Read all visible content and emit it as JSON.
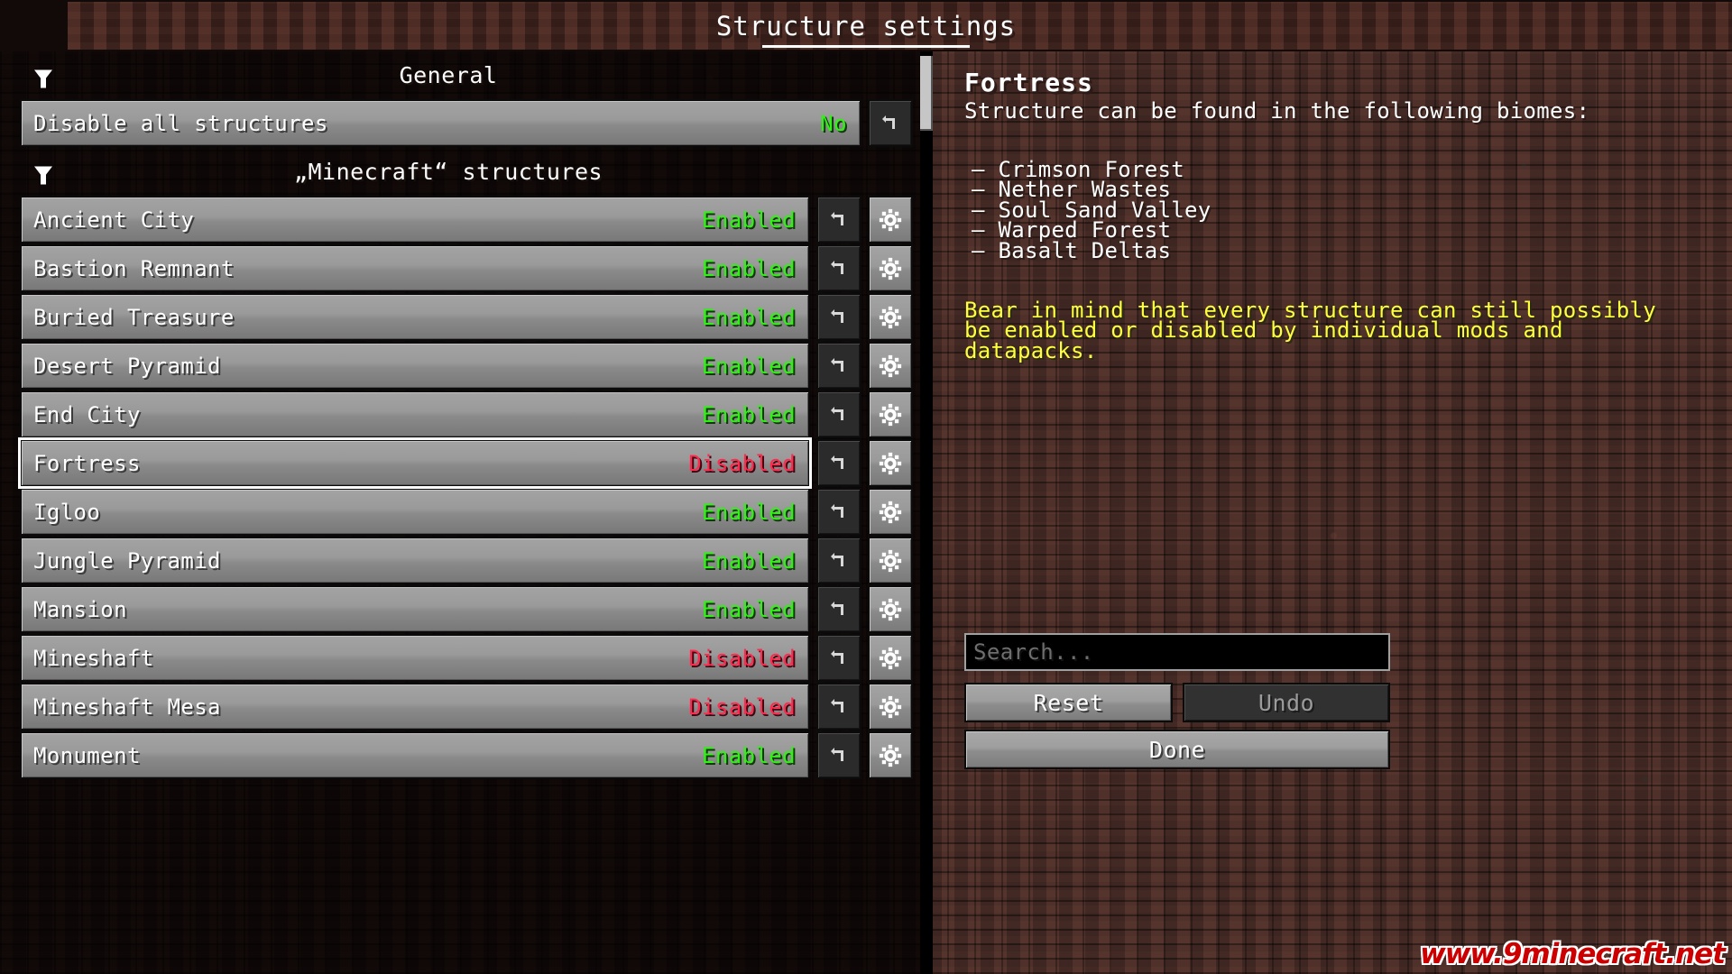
{
  "window": {
    "title": "Structure settings"
  },
  "list": {
    "sections": [
      {
        "label": "General",
        "caret": "caret-down-icon"
      },
      {
        "label": "„Minecraft“ structures",
        "caret": "caret-down-icon"
      }
    ],
    "general_rows": [
      {
        "label": "Disable all structures",
        "value": "No",
        "state": "no",
        "has_gear": false
      }
    ],
    "structure_rows": [
      {
        "label": "Ancient City",
        "value": "Enabled",
        "state": "enabled",
        "selected": false
      },
      {
        "label": "Bastion Remnant",
        "value": "Enabled",
        "state": "enabled",
        "selected": false
      },
      {
        "label": "Buried Treasure",
        "value": "Enabled",
        "state": "enabled",
        "selected": false
      },
      {
        "label": "Desert Pyramid",
        "value": "Enabled",
        "state": "enabled",
        "selected": false
      },
      {
        "label": "End City",
        "value": "Enabled",
        "state": "enabled",
        "selected": false
      },
      {
        "label": "Fortress",
        "value": "Disabled",
        "state": "disabled",
        "selected": true
      },
      {
        "label": "Igloo",
        "value": "Enabled",
        "state": "enabled",
        "selected": false
      },
      {
        "label": "Jungle Pyramid",
        "value": "Enabled",
        "state": "enabled",
        "selected": false
      },
      {
        "label": "Mansion",
        "value": "Enabled",
        "state": "enabled",
        "selected": false
      },
      {
        "label": "Mineshaft",
        "value": "Disabled",
        "state": "disabled",
        "selected": false
      },
      {
        "label": "Mineshaft Mesa",
        "value": "Disabled",
        "state": "disabled",
        "selected": false
      },
      {
        "label": "Monument",
        "value": "Enabled",
        "state": "enabled",
        "selected": false
      }
    ],
    "icons": {
      "reset": "reset-arrow-icon",
      "gear": "gear-icon"
    }
  },
  "info": {
    "title": "Fortress",
    "description": "Structure can be found in the following biomes:",
    "biomes": [
      "Crimson Forest",
      "Nether Wastes",
      "Soul Sand Valley",
      "Warped Forest",
      "Basalt Deltas"
    ],
    "note": "Bear in mind that every structure can still possibly be enabled or disabled by individual mods and datapacks.",
    "note_color": "#ffff3f"
  },
  "controls": {
    "search_placeholder": "Search...",
    "search_value": "",
    "reset_label": "Reset",
    "undo_label": "Undo",
    "done_label": "Done"
  },
  "watermark": {
    "text": "www.9minecraft.net",
    "color": "#cc0000"
  }
}
